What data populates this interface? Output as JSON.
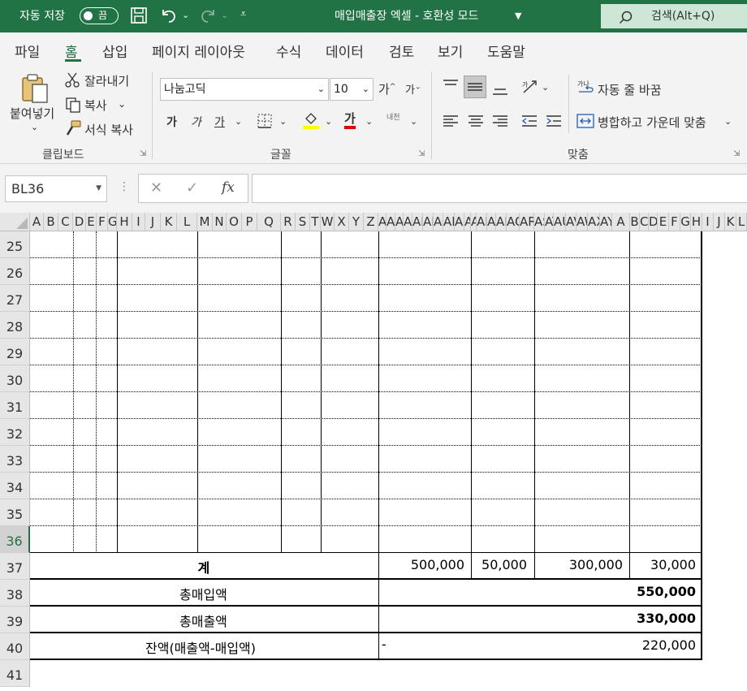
{
  "titlebar": {
    "autosave_label": "자동 저장",
    "toggle_state": "끔",
    "title": "매입매출장 엑셀  -  호환성 모드",
    "search": "검색(Alt+Q)"
  },
  "menu": {
    "items": [
      "파일",
      "홈",
      "삽입",
      "페이지 레이아웃",
      "수식",
      "데이터",
      "검토",
      "보기",
      "도움말"
    ],
    "active": "홈"
  },
  "ribbon": {
    "clipboard": {
      "paste": "붙여넣기",
      "cut": "잘라내기",
      "copy": "복사",
      "format_painter": "서식 복사",
      "group": "클립보드"
    },
    "font": {
      "name": "나눔고딕",
      "size": "10",
      "grow": "가",
      "shrink": "가",
      "bold": "가",
      "italic": "가",
      "underline": "가",
      "font_color": "가",
      "phonetic": "내천",
      "group": "글꼴"
    },
    "alignment": {
      "wrap": "자동 줄 바꿈",
      "merge": "병합하고 가운데 맞춤",
      "group": "맞춤"
    }
  },
  "formula_bar": {
    "name_box": "BL36",
    "fx": "fx",
    "formula": ""
  },
  "sheet": {
    "columns": [
      "A",
      "B",
      "C",
      "D",
      "E",
      "F",
      "G",
      "H",
      "I",
      "J",
      "K",
      "L",
      "M",
      "N",
      "O",
      "P",
      "Q",
      "R",
      "S",
      "T",
      "W",
      "X",
      "Y",
      "Z",
      "AA",
      "AE",
      "AC",
      "AD",
      "AE",
      "AF",
      "AG",
      "AH",
      "AI",
      "AJ",
      "AL",
      "AM",
      "AN",
      "AP",
      "AQ",
      "AR",
      "AS",
      "AT",
      "AU",
      "AV",
      "AW",
      "AX",
      "AY"
    ],
    "rows": [
      "25",
      "26",
      "27",
      "28",
      "29",
      "30",
      "31",
      "32",
      "33",
      "34",
      "35",
      "36",
      "37",
      "38",
      "39",
      "40",
      "41"
    ],
    "selected_row": "36",
    "total_label": "계",
    "totals": [
      "500,000",
      "50,000",
      "300,000",
      "30,000"
    ],
    "summary": [
      {
        "label": "총매입액",
        "value": "550,000",
        "bold": true
      },
      {
        "label": "총매출액",
        "value": "330,000",
        "bold": true
      },
      {
        "label": "잔액(매출액-매입액)",
        "dash": "-",
        "value": "220,000",
        "bold": false
      }
    ]
  }
}
